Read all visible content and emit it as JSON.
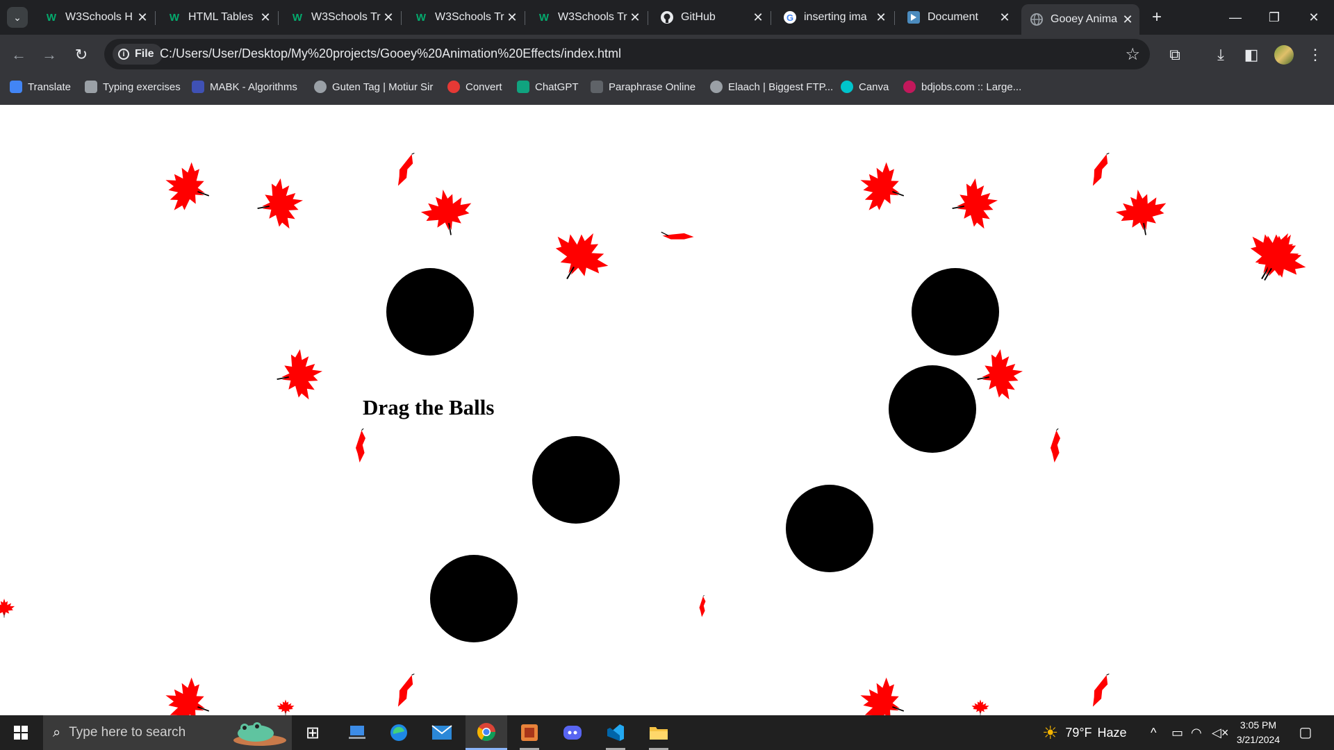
{
  "browser": {
    "tabs": [
      {
        "title": "W3Schools H",
        "icon": "w3schools-icon",
        "active": false
      },
      {
        "title": "HTML Tables",
        "icon": "w3schools-icon",
        "active": false
      },
      {
        "title": "W3Schools Tr",
        "icon": "w3schools-icon",
        "active": false
      },
      {
        "title": "W3Schools Tr",
        "icon": "w3schools-icon",
        "active": false
      },
      {
        "title": "W3Schools Tr",
        "icon": "w3schools-icon",
        "active": false
      },
      {
        "title": "GitHub",
        "icon": "github-icon",
        "active": false
      },
      {
        "title": "inserting ima",
        "icon": "google-icon",
        "active": false
      },
      {
        "title": "Document",
        "icon": "document-icon",
        "active": false
      },
      {
        "title": "Gooey Anima",
        "icon": "globe-icon",
        "active": true
      }
    ],
    "address": {
      "scheme_chip": "File",
      "url": "C:/Users/User/Desktop/My%20projects/Gooey%20Animation%20Effects/index.html"
    },
    "bookmarks": [
      {
        "label": "Translate",
        "icon": "translate-icon",
        "color": "#4285f4"
      },
      {
        "label": "Typing exercises",
        "icon": "keyboard-icon",
        "color": "#9aa0a6"
      },
      {
        "label": "MABK - Algorithms",
        "icon": "mabk-icon",
        "color": "#3f51b5"
      },
      {
        "label": "Guten Tag | Motiur Sir",
        "icon": "globe-icon",
        "color": "#9aa0a6"
      },
      {
        "label": "Convert",
        "icon": "convert-icon",
        "color": "#e53935"
      },
      {
        "label": "ChatGPT",
        "icon": "chatgpt-icon",
        "color": "#10a37f"
      },
      {
        "label": "Paraphrase Online",
        "icon": "paraphrase-icon",
        "color": "#5f6368"
      },
      {
        "label": "Elaach | Biggest FTP...",
        "icon": "globe-icon",
        "color": "#9aa0a6"
      },
      {
        "label": "Canva",
        "icon": "canva-icon",
        "color": "#00c4cc"
      },
      {
        "label": "bdjobs.com :: Large...",
        "icon": "bdjobs-icon",
        "color": "#c2185b"
      }
    ]
  },
  "page": {
    "heading": "Drag the Balls",
    "leaf_color": "#ff0000",
    "ball_color": "#000000"
  },
  "taskbar": {
    "search_placeholder": "Type here to search",
    "weather": {
      "temp": "79°F",
      "condition": "Haze"
    },
    "time": "3:05 PM",
    "date": "3/21/2024"
  }
}
